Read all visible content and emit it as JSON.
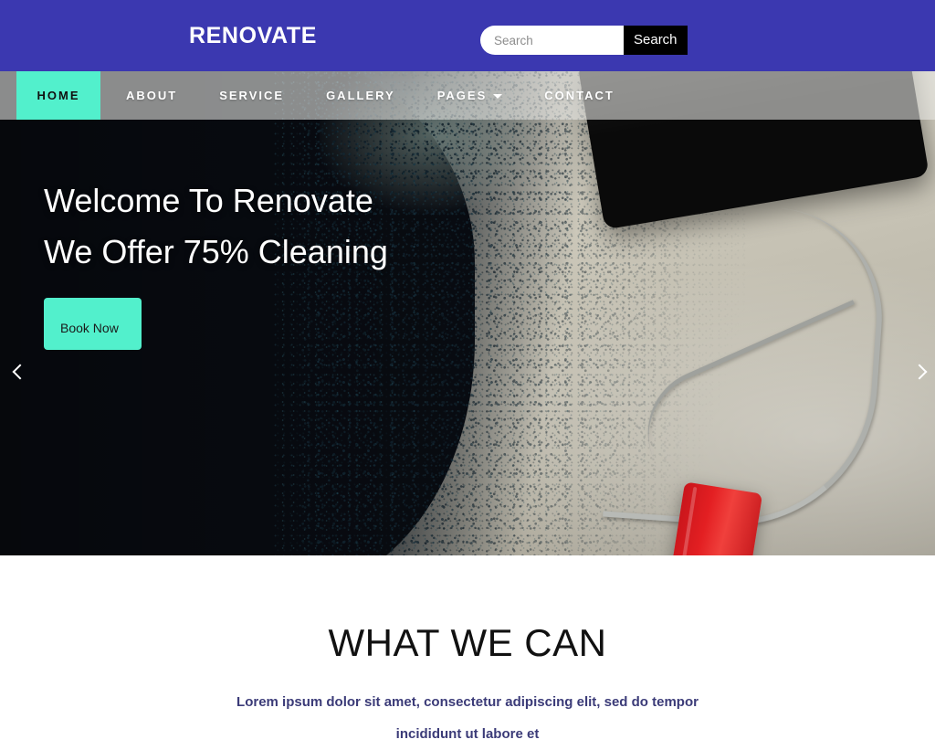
{
  "theme": {
    "header_purple": "#3b38b0",
    "accent_cyan": "#52f0cc",
    "button_black": "#000000",
    "subtitle_indigo": "#3b3b78",
    "text_white": "#ffffff"
  },
  "header": {
    "brand": "RENOVATE",
    "search": {
      "placeholder": "Search",
      "value": "",
      "button_label": "Search"
    }
  },
  "nav": {
    "items": [
      {
        "label": "HOME",
        "active": true,
        "has_caret": false
      },
      {
        "label": "ABOUT",
        "active": false,
        "has_caret": false
      },
      {
        "label": "SERVICE",
        "active": false,
        "has_caret": false
      },
      {
        "label": "GALLERY",
        "active": false,
        "has_caret": false
      },
      {
        "label": "PAGES",
        "active": false,
        "has_caret": true
      },
      {
        "label": "CONTACT",
        "active": false,
        "has_caret": false
      }
    ]
  },
  "hero": {
    "line1": "Welcome To Renovate",
    "line2": "We Offer 75% Cleaning",
    "cta_label": "Book Now",
    "prev_arrow": "‹",
    "next_arrow": "›"
  },
  "section": {
    "title": "WHAT WE CAN",
    "subtitle": "Lorem ipsum dolor sit amet, consectetur adipiscing elit, sed do tempor incididunt ut labore et"
  }
}
